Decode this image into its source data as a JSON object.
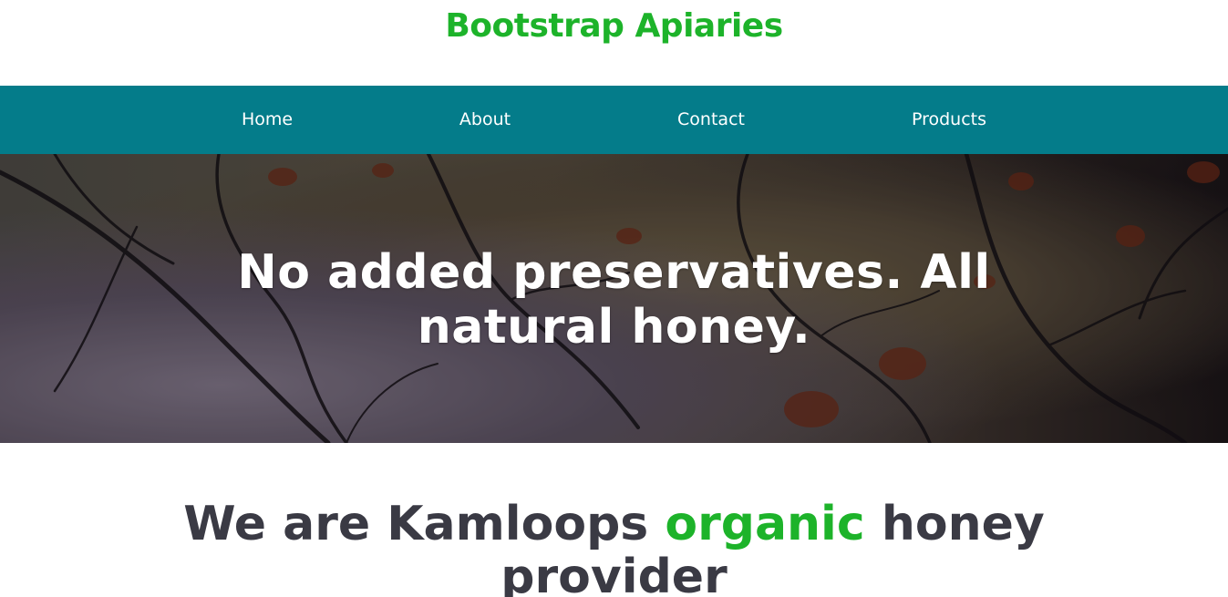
{
  "header": {
    "brand": "Bootstrap Apiaries"
  },
  "nav": {
    "items": [
      {
        "label": "Home"
      },
      {
        "label": "About"
      },
      {
        "label": "Contact"
      },
      {
        "label": "Products"
      }
    ]
  },
  "hero": {
    "title": "No added preservatives. All natural honey."
  },
  "intro": {
    "title_before": "We are Kamloops ",
    "title_accent": "organic",
    "title_after": " honey provider"
  },
  "colors": {
    "brand_green": "#1db32a",
    "nav_teal": "#047c8a",
    "heading_dark": "#3a3a44"
  }
}
